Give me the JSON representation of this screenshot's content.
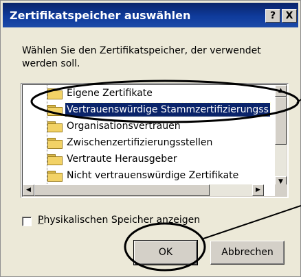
{
  "dialog": {
    "title": "Zertifikatspeicher auswählen",
    "help_button": "?",
    "close_button": "X",
    "instruction": "Wählen Sie den Zertifikatspeicher, der verwendet werden soll."
  },
  "stores": [
    {
      "label": "Eigene Zertifikate",
      "selected": false
    },
    {
      "label": "Vertrauenswürdige Stammzertifizierungss",
      "selected": true
    },
    {
      "label": "Organisationsvertrauen",
      "selected": false
    },
    {
      "label": "Zwischenzertifizierungsstellen",
      "selected": false
    },
    {
      "label": "Vertraute Herausgeber",
      "selected": false
    },
    {
      "label": "Nicht vertrauenswürdige Zertifikate",
      "selected": false
    }
  ],
  "physical_store": {
    "label_underlined": "P",
    "label_rest": "hysikalischen Speicher anzeigen",
    "checked": false
  },
  "buttons": {
    "ok": "OK",
    "cancel": "Abbrechen"
  },
  "colors": {
    "titlebar": "#0a246a",
    "selection": "#0a246a",
    "annotation": "#000000"
  }
}
